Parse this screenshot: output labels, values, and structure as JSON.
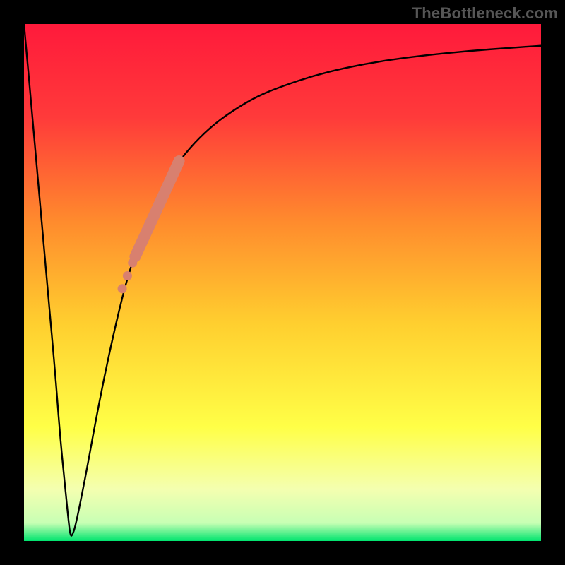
{
  "watermark": "TheBottleneck.com",
  "colors": {
    "frame": "#000000",
    "curve": "#000000",
    "dots": "#d8806f",
    "gradient_stops": [
      {
        "offset": 0.0,
        "color": "#ff1a3b"
      },
      {
        "offset": 0.18,
        "color": "#ff3a3a"
      },
      {
        "offset": 0.38,
        "color": "#ff8a2d"
      },
      {
        "offset": 0.58,
        "color": "#ffcf2f"
      },
      {
        "offset": 0.78,
        "color": "#ffff47"
      },
      {
        "offset": 0.9,
        "color": "#f4ffb0"
      },
      {
        "offset": 0.965,
        "color": "#c8ffb4"
      },
      {
        "offset": 1.0,
        "color": "#00e46e"
      }
    ]
  },
  "chart_data": {
    "type": "line",
    "title": "",
    "xlabel": "",
    "ylabel": "",
    "xlim": [
      0,
      100
    ],
    "ylim": [
      0,
      100
    ],
    "series": [
      {
        "name": "bottleneck-curve",
        "x": [
          0,
          2,
          4,
          6,
          7,
          8,
          8.7,
          9.0,
          9.3,
          10,
          12,
          14,
          16,
          18,
          20,
          23,
          26,
          29,
          32,
          36,
          40,
          45,
          50,
          56,
          62,
          70,
          78,
          86,
          94,
          100
        ],
        "y": [
          100,
          78,
          55,
          33,
          20,
          10,
          3,
          1,
          1,
          3,
          13,
          24,
          34,
          43,
          51,
          60,
          67,
          72,
          76,
          80,
          83,
          86,
          88,
          90,
          91.5,
          93,
          94,
          94.8,
          95.4,
          95.8
        ]
      }
    ],
    "highlight_band": {
      "name": "highlight-segment",
      "x": [
        21.5,
        30.0
      ],
      "y": [
        55.0,
        73.5
      ]
    },
    "highlight_dots": [
      {
        "x": 19.0,
        "y": 48.8
      },
      {
        "x": 20.0,
        "y": 51.3
      },
      {
        "x": 21.0,
        "y": 53.8
      }
    ]
  }
}
